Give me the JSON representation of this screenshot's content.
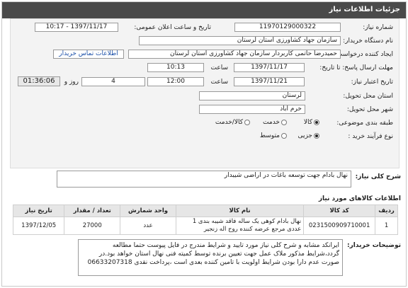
{
  "header": {
    "title": "جزئیات اطلاعات نیاز"
  },
  "form": {
    "need_number_label": "شماره نیاز:",
    "need_number": "11970129000322",
    "announce_label": "تاریخ و ساعت اعلان عمومی:",
    "announce_value": "1397/11/17 - 10:17",
    "buyer_org_label": "نام دستگاه خریدار:",
    "buyer_org": "سازمان جهاد کشاورزی استان لرستان",
    "creator_label": "ایجاد کننده درخواست:",
    "creator": "حمیدرضا حاتمی کاربردار سازمان جهاد کشاورزی استان لرستان",
    "contact_link": "اطلاعات تماس خریدار",
    "send_deadline_label": "مهلت ارسال پاسخ: تا تاریخ:",
    "send_date": "1397/11/17",
    "time_label": "ساعت",
    "send_time": "10:13",
    "validity_label": "تاریخ اعتبار نیاز:",
    "validity_date": "1397/11/21",
    "validity_time": "12:00",
    "days": "4",
    "days_label": "روز و",
    "remaining_time": "01:36:06",
    "remaining_label": "ساعت باقی مانده",
    "province_label": "استان محل تحویل:",
    "province": "لرستان",
    "city_label": "شهر محل تحویل:",
    "city": "خرم آباد",
    "category_label": "طبقه بندی موضوعی:",
    "category_options": [
      "کالا",
      "خدمت",
      "کالا/خدمت"
    ],
    "process_label": "نوع فرآیند خرید :",
    "process_options": [
      "جزیی",
      "متوسط"
    ]
  },
  "summary": {
    "label": "شرح کلی نیاز:",
    "text": "نهال بادام جهت توسعه باغات در اراضی شیبدار"
  },
  "goods": {
    "section_label": "اطلاعات کالاهای مورد نیاز",
    "headers": [
      "ردیف",
      "کد کالا",
      "نام کالا",
      "واحد شمارش",
      "تعداد / مقدار",
      "تاریخ نیاز"
    ],
    "rows": [
      [
        "1",
        "0231500909710001",
        "نهال بادام کوهی یک ساله فاقد شیبه بندی 1 عددی مرجع عرضه کننده روح اله زنجیر",
        "عدد",
        "27000",
        "1397/12/05"
      ]
    ]
  },
  "notes": {
    "label": "توضیحات خریدار:",
    "text": "ایرانکد مشابه و شرح کلی نیاز مورد تایید و شرایط مندرج در فایل پیوست حتما مطالعه گردد،شرایط مذکور ملاک عمل جهت تعیین برنده توسط کمیته فنی نهال استان خواهد بود.در صورت عدم دارا بودن شرایط اولویت با تامین کننده بعدی است ،پرداخت نقدی 06633207318"
  }
}
